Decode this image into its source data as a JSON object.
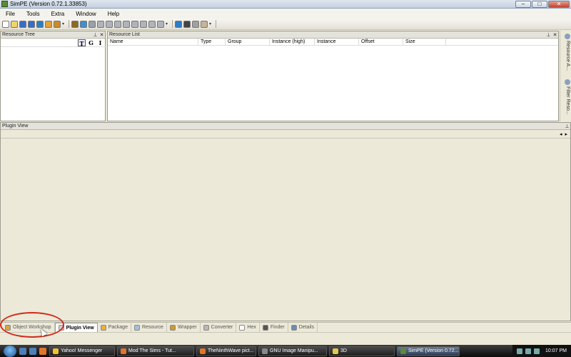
{
  "window": {
    "title": "SimPE (Version 0.72.1.33853)"
  },
  "menu": [
    "File",
    "Tools",
    "Extra",
    "Window",
    "Help"
  ],
  "toolbar": {
    "icons": [
      "new-icon",
      "open-icon",
      "save-icon",
      "save-as-icon",
      "globe-icon",
      "users-icon",
      "package-icon",
      "grip",
      "lock-icon",
      "export-icon",
      "car-icon",
      "grid-icon",
      "stack-icon",
      "cube-icon",
      "pages-icon",
      "pages2-icon",
      "pages3-icon",
      "monitor-icon",
      "screen-icon",
      "grip",
      "refresh-icon",
      "person-icon",
      "cross-icon",
      "tag-icon",
      "grip"
    ],
    "colors": [
      "#ffffff",
      "#f1d36a",
      "#3a6cc2",
      "#3a6cc2",
      "#2f7fbf",
      "#e3a23a",
      "#c98c2a",
      "",
      "#8a6b1f",
      "#3f8fd0",
      "#9aa1aa",
      "#b0b4ba",
      "#b0b4ba",
      "#b0b4ba",
      "#b0b4ba",
      "#b0b4ba",
      "#b0b4ba",
      "#b0b4ba",
      "#b0b4ba",
      "",
      "#2e7dc9",
      "#444444",
      "#a0a0a0",
      "#c8b39a",
      ""
    ]
  },
  "resource_tree": {
    "title": "Resource Tree",
    "sort_buttons": [
      "T",
      "G",
      "I"
    ]
  },
  "resource_list": {
    "title": "Resource List",
    "columns": [
      "Name",
      "Type",
      "Group",
      "Instance (high)",
      "Instance",
      "Offset",
      "Size"
    ]
  },
  "side_tabs": [
    "Resource A...",
    "Filter Reso..."
  ],
  "plugin_view": {
    "title": "Plugin View"
  },
  "bottom_tabs": [
    {
      "label": "Object Workshop",
      "active": false,
      "color": "#d8a545"
    },
    {
      "label": "Plugin View",
      "active": true,
      "color": "#cfcfcf"
    },
    {
      "label": "Package",
      "active": false,
      "color": "#e7b13f"
    },
    {
      "label": "Resource",
      "active": false,
      "color": "#a6c0d8"
    },
    {
      "label": "Wrapper",
      "active": false,
      "color": "#d09a2d"
    },
    {
      "label": "Converter",
      "active": false,
      "color": "#b8b8b8"
    },
    {
      "label": "Hex",
      "active": false,
      "color": "#ffffff"
    },
    {
      "label": "Finder",
      "active": false,
      "color": "#555555"
    },
    {
      "label": "Details",
      "active": false,
      "color": "#6c8cb4"
    }
  ],
  "taskbar": {
    "buttons": [
      {
        "label": "Yahoo! Messenger",
        "color": "#f2c232"
      },
      {
        "label": "Mod The Sims - Tut...",
        "color": "#e0762a"
      },
      {
        "label": "TheNinthWave pict...",
        "color": "#e0762a"
      },
      {
        "label": "GNU Image Manipu...",
        "color": "#888888"
      },
      {
        "label": "3D",
        "color": "#e8c64a"
      },
      {
        "label": "SimPE (Version 0.72....",
        "color": "#5a8a3a",
        "active": true
      }
    ],
    "clock": "10:07 PM"
  }
}
